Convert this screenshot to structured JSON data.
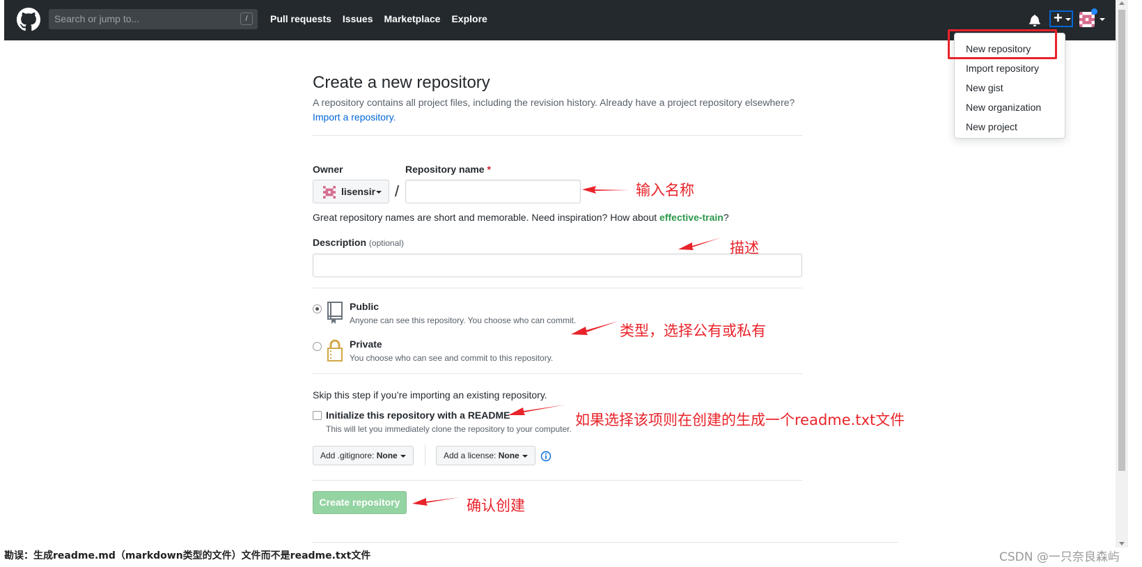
{
  "header": {
    "search_placeholder": "Search or jump to...",
    "search_shortcut": "/",
    "nav": [
      "Pull requests",
      "Issues",
      "Marketplace",
      "Explore"
    ],
    "plus_glyph": "+"
  },
  "dropdown": {
    "items": [
      "New repository",
      "Import repository",
      "New gist",
      "New organization",
      "New project"
    ]
  },
  "form": {
    "title": "Create a new repository",
    "subtitle": "A repository contains all project files, including the revision history. Already have a project repository elsewhere?",
    "import_link": "Import a repository.",
    "owner_label": "Owner",
    "repo_name_label": "Repository name",
    "required_mark": "*",
    "owner_value": "lisensir",
    "slash": "/",
    "hint_prefix": "Great repository names are short and memorable. Need inspiration? How about",
    "hint_suggestion": "effective-train",
    "hint_suffix": "?",
    "description_label": "Description",
    "description_optional": "(optional)",
    "public_title": "Public",
    "public_note": "Anyone can see this repository. You choose who can commit.",
    "private_title": "Private",
    "private_note": "You choose who can see and commit to this repository.",
    "skip_text": "Skip this step if you’re importing an existing repository.",
    "readme_label": "Initialize this repository with a README",
    "readme_note": "This will let you immediately clone the repository to your computer.",
    "gitignore_prefix": "Add .gitignore:",
    "gitignore_value": "None",
    "license_prefix": "Add a license:",
    "license_value": "None",
    "create_label": "Create repository"
  },
  "annotations": {
    "name": "输入名称",
    "description": "描述",
    "type": "类型，选择公有或私有",
    "readme": "如果选择该项则在创建的生成一个readme.txt文件",
    "confirm": "确认创建"
  },
  "footer": {
    "erratum": "勘误：生成readme.md（markdown类型的文件）文件而不是readme.txt文件",
    "watermark": "CSDN @一只奈良森屿"
  },
  "colors": {
    "header_bg": "#24292e",
    "link": "#0366d6",
    "annotation_red": "#e8232a",
    "create_button": "#94d3a2"
  }
}
